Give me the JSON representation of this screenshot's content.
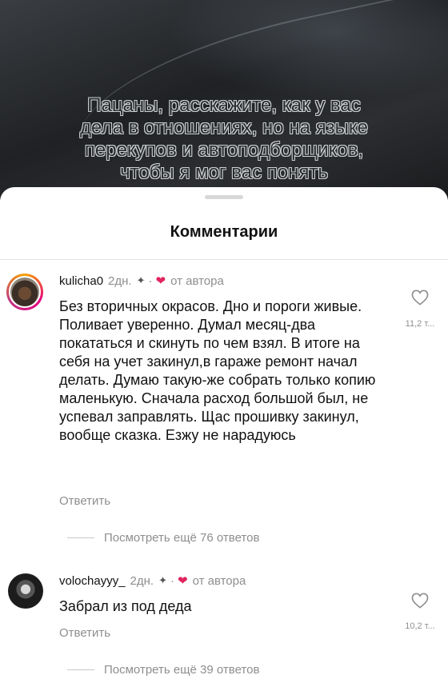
{
  "background": {
    "overlay_lines": [
      "Пацаны, расскажите, как у вас",
      "дела в отношениях, но на языке",
      "перекупов и автоподборщиков,",
      "чтобы я мог вас понять"
    ]
  },
  "sheet": {
    "title": "Комментарии"
  },
  "comments": [
    {
      "username": "kulicha0",
      "time": "2дн.",
      "author_badge": "от автора",
      "text": "Без вторичных окрасов. Дно и пороги живые. Поливает уверенно. Думал месяц-два покататься и скинуть по чем взял. В итоге на себя на учет закинул,в гараже ремонт начал делать. Думаю такую-же собрать только копию маленькую. Сначала расход большой был, не успевал заправлять. Щас прошивку закинул, вообще сказка. Езжу не нарадуюсь",
      "reply_label": "Ответить",
      "likes": "11,2 т...",
      "view_replies": "Посмотреть ещё 76 ответов"
    },
    {
      "username": "volochayyy_",
      "time": "2дн.",
      "author_badge": "от автора",
      "text": "Забрал из под деда",
      "reply_label": "Ответить",
      "likes": "10,2 т...",
      "view_replies": "Посмотреть ещё 39 ответов"
    }
  ],
  "colors": {
    "heart_accent": "#e0245e",
    "muted_text": "#8e8e8e"
  }
}
